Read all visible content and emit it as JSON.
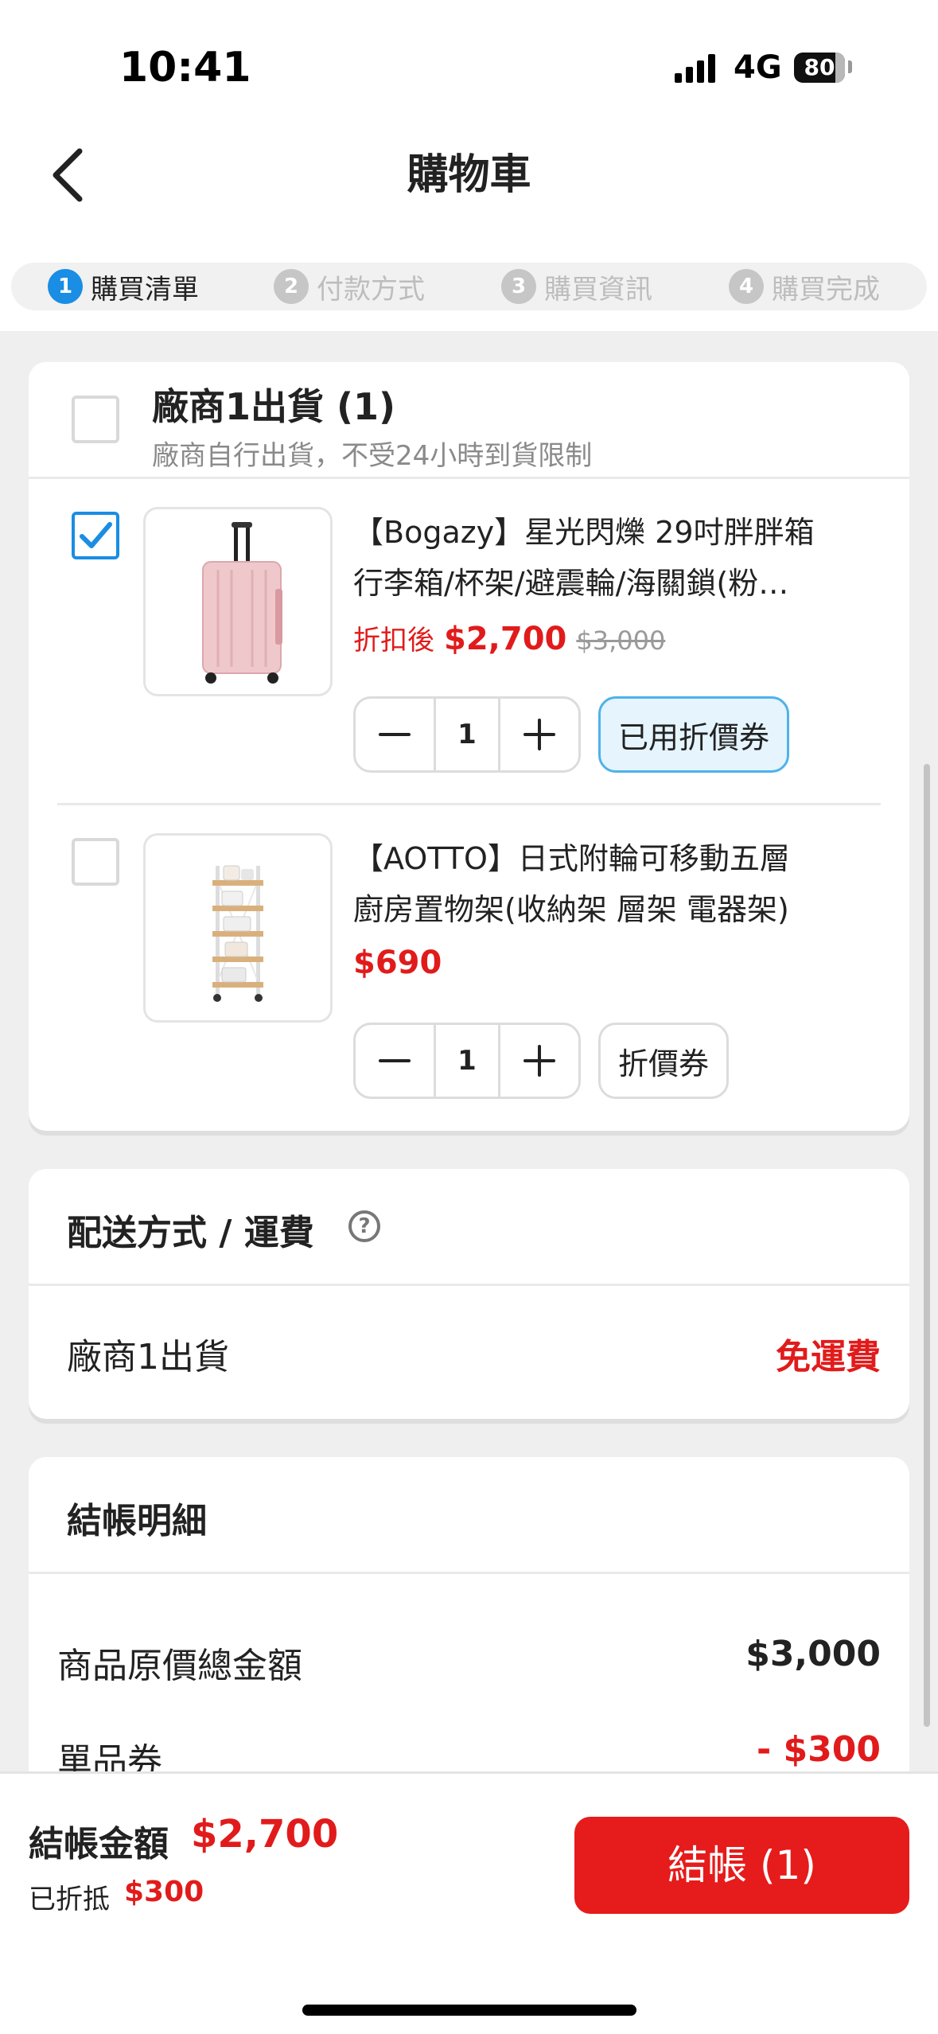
{
  "status_bar": {
    "time": "10:41",
    "network": "4G",
    "battery": "80"
  },
  "header": {
    "title": "購物車",
    "back_icon": "chevron-left-icon"
  },
  "steps": [
    {
      "num": "1",
      "label": "購買清單",
      "active": true
    },
    {
      "num": "2",
      "label": "付款方式",
      "active": false
    },
    {
      "num": "3",
      "label": "購買資訊",
      "active": false
    },
    {
      "num": "4",
      "label": "購買完成",
      "active": false
    }
  ],
  "vendor": {
    "title": "廠商1出貨 (1)",
    "subtitle": "廠商自行出貨，不受24小時到貨限制",
    "checked": false
  },
  "items": [
    {
      "checked": true,
      "name_line1": "【Bogazy】星光閃爍 29吋胖胖箱",
      "name_line2": "行李箱/杯架/避震輪/海關鎖(粉…",
      "price_prefix": "折扣後",
      "price": "$2,700",
      "original_price": "$3,000",
      "quantity": "1",
      "coupon_label": "已用折價券",
      "coupon_used": true,
      "image_icon": "pink-suitcase-icon"
    },
    {
      "checked": false,
      "name_line1": "【AOTTO】日式附輪可移動五層",
      "name_line2": "廚房置物架(收納架 層架 電器架)",
      "price": "$690",
      "quantity": "1",
      "coupon_label": "折價券",
      "coupon_used": false,
      "image_icon": "shelf-rack-icon"
    }
  ],
  "shipping": {
    "title": "配送方式 / 運費",
    "help_icon": "?",
    "vendor_label": "廠商1出貨",
    "fee_label": "免運費"
  },
  "summary": {
    "title": "結帳明細",
    "rows": [
      {
        "label": "商品原價總金額",
        "value": "$3,000"
      },
      {
        "label": "單品券",
        "value": "- $300"
      }
    ]
  },
  "footer": {
    "total_label": "結帳金額",
    "total_value": "$2,700",
    "discount_label": "已折抵",
    "discount_value": "$300",
    "checkout_label": "結帳 (1)"
  },
  "colors": {
    "accent": "#1a8de4",
    "price_red": "#e11b1b",
    "checkout_red": "#e61b1b",
    "coupon_bg": "#e5f4fd"
  }
}
